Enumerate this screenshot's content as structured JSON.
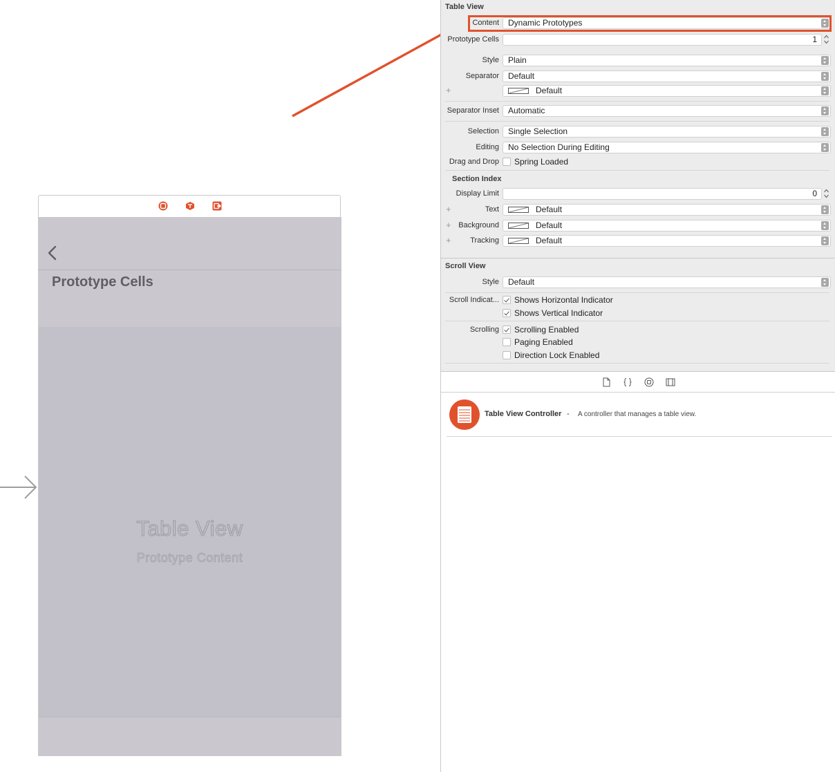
{
  "canvas": {
    "large_title": "Prototype Cells",
    "table_title": "Table View",
    "table_subtitle": "Prototype Content"
  },
  "inspector": {
    "table_view": {
      "header": "Table View",
      "content": {
        "label": "Content",
        "value": "Dynamic Prototypes"
      },
      "prototype_cells": {
        "label": "Prototype Cells",
        "value": "1"
      },
      "style": {
        "label": "Style",
        "value": "Plain"
      },
      "separator": {
        "label": "Separator",
        "value": "Default"
      },
      "separator_color": {
        "value": "Default"
      },
      "separator_inset": {
        "label": "Separator Inset",
        "value": "Automatic"
      },
      "selection": {
        "label": "Selection",
        "value": "Single Selection"
      },
      "editing": {
        "label": "Editing",
        "value": "No Selection During Editing"
      },
      "drag_drop": {
        "label": "Drag and Drop",
        "option": "Spring Loaded",
        "checked": false
      }
    },
    "section_index": {
      "header": "Section Index",
      "display_limit": {
        "label": "Display Limit",
        "value": "0"
      },
      "text": {
        "label": "Text",
        "value": "Default"
      },
      "background": {
        "label": "Background",
        "value": "Default"
      },
      "tracking": {
        "label": "Tracking",
        "value": "Default"
      }
    },
    "scroll_view": {
      "header": "Scroll View",
      "style": {
        "label": "Style",
        "value": "Default"
      },
      "indicators": {
        "label": "Scroll Indicat...",
        "horizontal": "Shows Horizontal Indicator",
        "vertical": "Shows Vertical Indicator"
      },
      "scrolling": {
        "label": "Scrolling",
        "enabled": "Scrolling Enabled",
        "paging": "Paging Enabled",
        "direction_lock": "Direction Lock Enabled"
      }
    },
    "library": {
      "name": "Table View Controller",
      "separator": "-",
      "description": "A controller that manages a table view."
    }
  },
  "colors": {
    "accent": "#e0522c",
    "canvas_gray": "#c2c0c8"
  },
  "icons": [
    "view-controller-icon",
    "first-responder-icon",
    "exit-icon",
    "back-chevron-icon",
    "file-icon",
    "code-braces-icon",
    "object-icon",
    "media-icon",
    "table-view-controller-icon"
  ]
}
